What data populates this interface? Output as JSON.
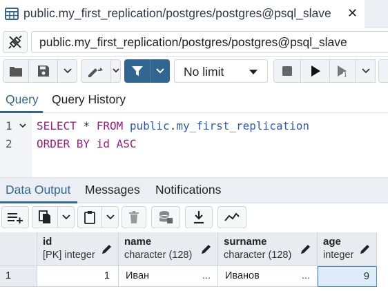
{
  "tab": {
    "title": "public.my_first_replication/postgres/postgres@psql_slave",
    "close_glyph": "✕",
    "icon": "table-icon"
  },
  "connection": {
    "value": "public.my_first_replication/postgres/postgres@psql_slave",
    "icon": "disconnect-icon"
  },
  "toolbar": {
    "limit_label": "No limit",
    "primary_color": "#326690"
  },
  "query_tabs": [
    {
      "label": "Query",
      "active": true
    },
    {
      "label": "Query History",
      "active": false
    }
  ],
  "editor": {
    "line_numbers": [
      "1",
      "2"
    ],
    "line1": {
      "kw1": "SELECT",
      "op": "*",
      "kw2": "FROM",
      "schema": "public",
      "dot": ".",
      "table": "my_first_replication"
    },
    "line2": {
      "kw1": "ORDER BY",
      "col": "id",
      "kw2": "ASC"
    }
  },
  "result_tabs": [
    {
      "label": "Data Output",
      "active": true
    },
    {
      "label": "Messages",
      "active": false
    },
    {
      "label": "Notifications",
      "active": false
    }
  ],
  "grid": {
    "columns": [
      {
        "name": "id",
        "type": "[PK] integer"
      },
      {
        "name": "name",
        "type": "character (128)"
      },
      {
        "name": "surname",
        "type": "character (128)"
      },
      {
        "name": "age",
        "type": "integer"
      }
    ],
    "rows": [
      {
        "rownum": "1",
        "id": "1",
        "name": "Иван",
        "surname": "Иванов",
        "age": "9"
      }
    ],
    "ellipsis": "..."
  }
}
